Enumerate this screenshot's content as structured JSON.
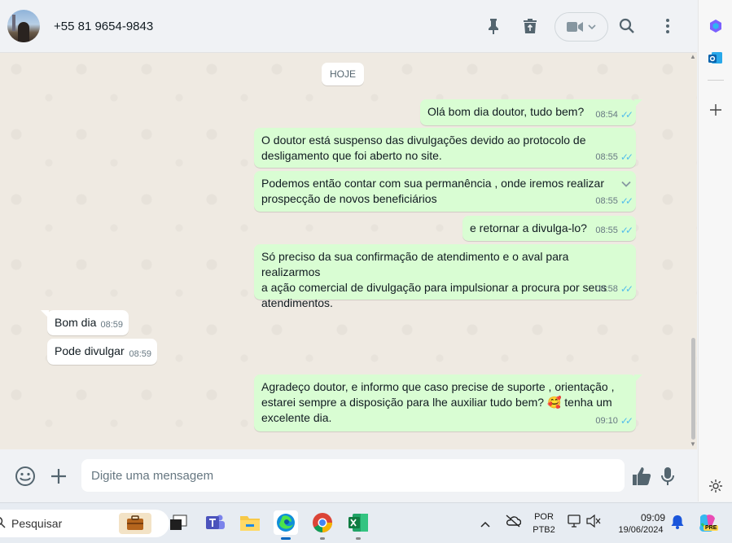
{
  "header": {
    "contact_name": "+55 81 9654-9843"
  },
  "chat": {
    "date_chip": "HOJE",
    "messages": [
      {
        "dir": "out",
        "lines": [
          "Olá bom dia doutor, tudo bem?"
        ],
        "time": "08:54"
      },
      {
        "dir": "out",
        "lines": [
          "O doutor está suspenso das divulgações devido ao protocolo de",
          "desligamento que foi aberto no site."
        ],
        "time": "08:55"
      },
      {
        "dir": "out",
        "lines": [
          "Podemos então contar com sua permanência , onde iremos realizar",
          "prospecção de novos beneficiários"
        ],
        "time": "08:55"
      },
      {
        "dir": "out",
        "lines": [
          "e retornar a divulga-lo?"
        ],
        "time": "08:55"
      },
      {
        "dir": "out",
        "lines": [
          "Só preciso da sua confirmação de atendimento e o aval para realizarmos",
          "a ação comercial de divulgação para impulsionar a procura por seus",
          "atendimentos."
        ],
        "time": "08:58"
      },
      {
        "dir": "in",
        "lines": [
          "Bom dia"
        ],
        "time": "08:59"
      },
      {
        "dir": "in",
        "lines": [
          "Pode divulgar"
        ],
        "time": "08:59"
      },
      {
        "dir": "out",
        "lines": [
          "Agradeço doutor, e informo que caso precise de suporte , orientação ,",
          "estarei sempre a disposição para lhe auxiliar tudo bem? 🥰 tenha um",
          "excelente dia."
        ],
        "time": "09:10"
      }
    ]
  },
  "composer": {
    "placeholder": "Digite uma mensagem"
  },
  "taskbar": {
    "search_label": "Pesquisar",
    "lang_top": "POR",
    "lang_bottom": "PTB2",
    "clock_time": "09:09",
    "clock_date": "19/06/2024",
    "copilot_badge": "PRE"
  },
  "colors": {
    "outgoing_bubble": "#d9fdd3",
    "incoming_bubble": "#ffffff",
    "read_ticks": "#53bdeb",
    "chat_background": "#efeae2"
  }
}
